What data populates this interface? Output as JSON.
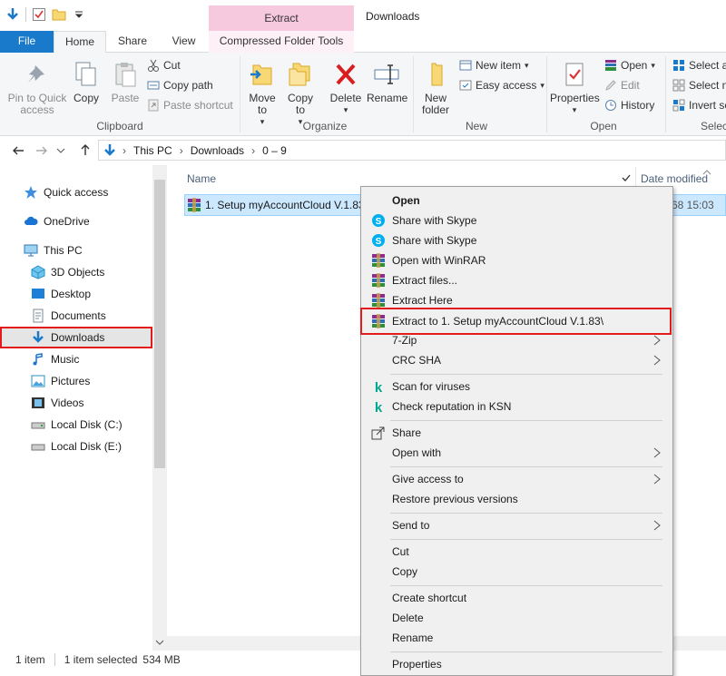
{
  "titlebar": {
    "context_tab_group": "Extract",
    "window_title": "Downloads"
  },
  "ribbon_tabs": {
    "file": "File",
    "home": "Home",
    "share": "Share",
    "view": "View",
    "compressed_folder_tools": "Compressed Folder Tools"
  },
  "ribbon": {
    "clipboard": {
      "pin": "Pin to Quick access",
      "copy": "Copy",
      "paste": "Paste",
      "cut": "Cut",
      "copy_path": "Copy path",
      "paste_shortcut": "Paste shortcut",
      "label": "Clipboard"
    },
    "organize": {
      "move_to": "Move to",
      "copy_to": "Copy to",
      "delete": "Delete",
      "rename": "Rename",
      "label": "Organize"
    },
    "new": {
      "new_folder": "New folder",
      "new_item": "New item",
      "easy_access": "Easy access",
      "label": "New"
    },
    "open": {
      "properties": "Properties",
      "open": "Open",
      "edit": "Edit",
      "history": "History",
      "label": "Open"
    },
    "select": {
      "select_all": "Select a",
      "select_none": "Select n",
      "invert": "Invert se",
      "label": "Selec"
    }
  },
  "address": {
    "path": [
      "This PC",
      "Downloads",
      "0 – 9"
    ]
  },
  "nav": {
    "items": [
      {
        "label": "Quick access",
        "icon": "star-icon"
      },
      {
        "label": "OneDrive",
        "icon": "cloud-icon"
      },
      {
        "label": "This PC",
        "icon": "computer-icon"
      },
      {
        "label": "3D Objects",
        "icon": "cube-icon"
      },
      {
        "label": "Desktop",
        "icon": "desktop-icon"
      },
      {
        "label": "Documents",
        "icon": "document-icon"
      },
      {
        "label": "Downloads",
        "icon": "download-icon"
      },
      {
        "label": "Music",
        "icon": "music-icon"
      },
      {
        "label": "Pictures",
        "icon": "pictures-icon"
      },
      {
        "label": "Videos",
        "icon": "videos-icon"
      },
      {
        "label": "Local Disk (C:)",
        "icon": "disk-icon"
      },
      {
        "label": "Local Disk (E:)",
        "icon": "disk-icon"
      }
    ]
  },
  "filelist": {
    "col_name": "Name",
    "col_date": "Date modified",
    "file_name": "1. Setup myAccountCloud V.1.83",
    "file_date_partial": "68 15:03"
  },
  "status": {
    "count": "1 item",
    "selected": "1 item selected",
    "size": "534 MB"
  },
  "context_menu": {
    "open": "Open",
    "share_skype_1": "Share with Skype",
    "share_skype_2": "Share with Skype",
    "open_winrar": "Open with WinRAR",
    "extract_files": "Extract files...",
    "extract_here": "Extract Here",
    "extract_to": "Extract to 1. Setup myAccountCloud V.1.83\\",
    "seven_zip": "7-Zip",
    "crc_sha": "CRC SHA",
    "scan": "Scan for viruses",
    "check_ksn": "Check reputation in KSN",
    "share": "Share",
    "open_with": "Open with",
    "give_access": "Give access to",
    "restore": "Restore previous versions",
    "send_to": "Send to",
    "cut": "Cut",
    "copy": "Copy",
    "create_shortcut": "Create shortcut",
    "delete": "Delete",
    "rename": "Rename",
    "properties": "Properties"
  },
  "colors": {
    "file_tab": "#1979ca",
    "selection": "#cce8ff",
    "highlight_border": "#e21b1b",
    "compressed_tab": "#f7c9df"
  }
}
